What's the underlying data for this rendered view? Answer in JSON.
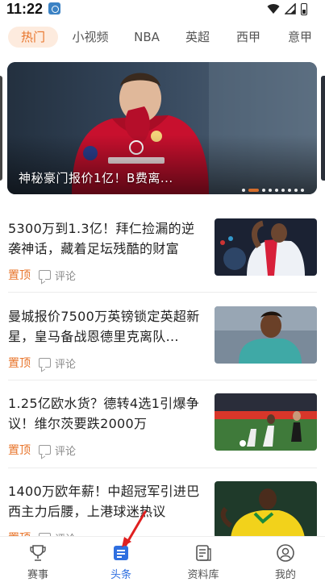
{
  "status_bar": {
    "time": "11:22"
  },
  "tabs": [
    {
      "label": "热门",
      "active": true
    },
    {
      "label": "小视频"
    },
    {
      "label": "NBA"
    },
    {
      "label": "英超"
    },
    {
      "label": "西甲"
    },
    {
      "label": "意甲"
    }
  ],
  "banner": {
    "caption": "神秘豪门报价1亿！B费离...",
    "slide_count": 9,
    "active_slide": 1
  },
  "news": [
    {
      "title": "5300万到1.3亿！拜仁捡漏的逆袭神话，藏着足坛残酷的财富",
      "pin_label": "置顶",
      "comment_label": "评论"
    },
    {
      "title": "曼城报价7500万英镑锁定英超新星，皇马备战恩德里克离队...",
      "pin_label": "置顶",
      "comment_label": "评论"
    },
    {
      "title": "1.25亿欧水货？德转4选1引爆争议！维尔茨要跌2000万",
      "pin_label": "置顶",
      "comment_label": "评论"
    },
    {
      "title": "1400万欧年薪！中超冠军引进巴西主力后腰，上港球迷热议",
      "pin_label": "置顶",
      "comment_label": "评论"
    }
  ],
  "bottom_nav": [
    {
      "label": "赛事",
      "icon": "trophy-icon"
    },
    {
      "label": "头条",
      "icon": "news-icon",
      "active": true
    },
    {
      "label": "资料库",
      "icon": "database-icon"
    },
    {
      "label": "我的",
      "icon": "profile-icon"
    }
  ],
  "colors": {
    "accent": "#e8742a",
    "active_nav": "#2f6fe0",
    "annotation_arrow": "#e02020"
  }
}
